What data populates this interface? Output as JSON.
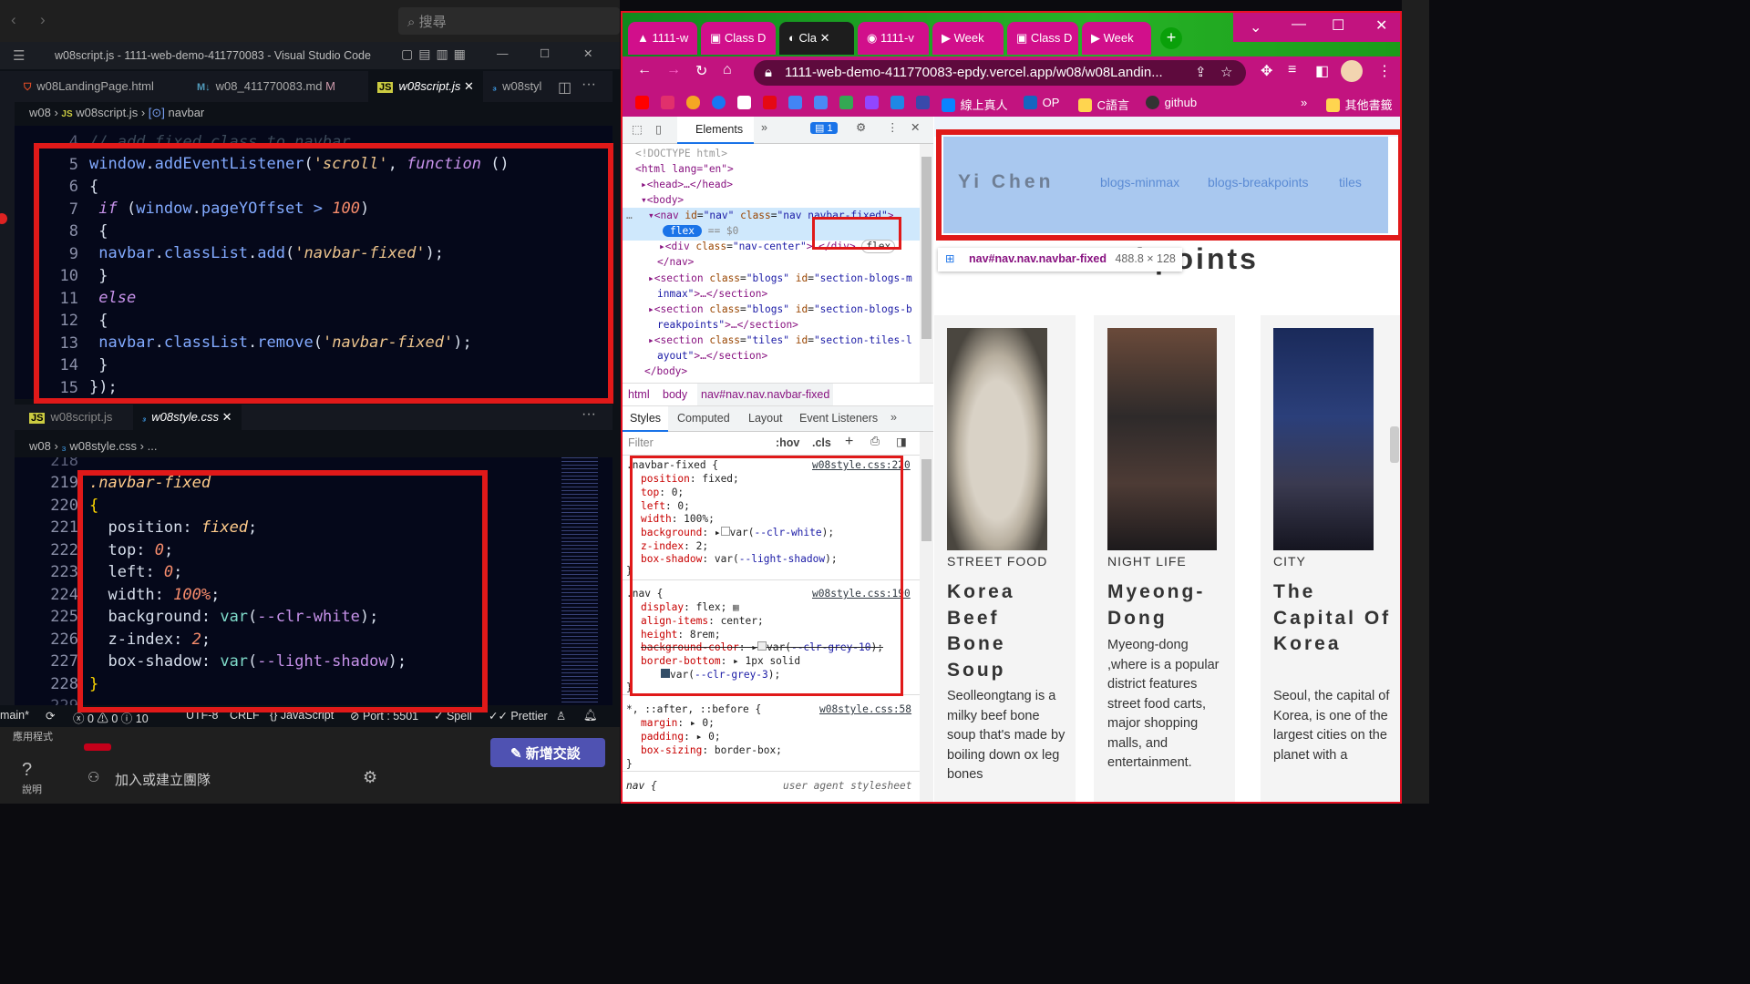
{
  "background": {
    "search_placeholder": "搜尋",
    "sidebar_apps_label": "應用程式",
    "help_label": "說明",
    "join_team_label": "加入或建立團隊",
    "new_chat_label": "新增交談"
  },
  "vscode": {
    "window_title": "w08script.js - 1111-web-demo-411770083 - Visual Studio Code",
    "tabs": [
      {
        "label": "w08LandingPage.html",
        "icon": "html-icon"
      },
      {
        "label": "w08_411770083.md",
        "badge": "M",
        "icon": "markdown-icon"
      },
      {
        "label": "w08script.js",
        "icon": "js-icon",
        "active": true
      },
      {
        "label": "w08styl",
        "icon": "css-icon"
      }
    ],
    "breadcrumb1": [
      "w08",
      "w08script.js",
      "navbar"
    ],
    "editor1": {
      "comment_line_no": "4",
      "comment": "// add fixed class to navbar",
      "line_numbers": [
        "5",
        "6",
        "7",
        "8",
        "9",
        "10",
        "11",
        "12",
        "13",
        "14",
        "15"
      ]
    },
    "lower_tabs": [
      {
        "label": "w08script.js"
      },
      {
        "label": "w08style.css",
        "active": true
      }
    ],
    "breadcrumb2": [
      "w08",
      "w08style.css",
      "..."
    ],
    "editor2": {
      "line_numbers": [
        "218",
        "219",
        "220",
        "221",
        "222",
        "223",
        "224",
        "225",
        "226",
        "227",
        "228",
        "229"
      ]
    },
    "status": {
      "branch": "main*",
      "problems": "0 ⚠ 0 ⓘ 10",
      "encoding": "UTF-8",
      "eol": "CRLF",
      "language": "JavaScript",
      "port": "Port : 5501",
      "spell": "Spell",
      "prettier": "Prettier"
    }
  },
  "chrome": {
    "tabs": [
      "1111-w",
      "Class D",
      "Cla",
      "1111-v",
      "Week ",
      "Class D",
      "Week "
    ],
    "url": "1111-web-demo-411770083-epdy.vercel.app/w08/w08Landin...",
    "bookmarks": [
      "線上真人",
      "OP",
      "C語言",
      "github",
      "其他書籤"
    ]
  },
  "devtools": {
    "tabs": [
      "Elements"
    ],
    "issues_count": "1",
    "breadcrumbs": [
      "html",
      "body",
      "nav#nav.nav.navbar-fixed"
    ],
    "subtabs": [
      "Styles",
      "Computed",
      "Layout",
      "Event Listeners"
    ],
    "filter_placeholder": "Filter",
    "hov": ":hov",
    "cls": ".cls",
    "dom": {
      "doctype": "<!DOCTYPE html>",
      "html_open": "<html lang=\"en\">",
      "head": "<head>…</head>",
      "body_open": "<body>",
      "nav_badge": "flex",
      "nav_eq": "== $0",
      "div_badge": "flex",
      "nav_close": "</nav>",
      "body_close": "</body>"
    },
    "styles": {
      "rule1_selector": ".navbar-fixed {",
      "rule1_source": "w08style.css:220",
      "rule2_selector": ".nav {",
      "rule2_source": "w08style.css:190",
      "rule3_selector": "*, ::after, ::before {",
      "rule3_source": "w08style.css:58",
      "rule4_selector": "nav {",
      "rule4_source": "user agent stylesheet"
    }
  },
  "page": {
    "logo": "Yi Chen",
    "nav_links": [
      "blogs-minmax",
      "blogs-breakpoints",
      "tiles"
    ],
    "tooltip_selector": "nav#nav.nav.navbar-fixed",
    "tooltip_size": "488.8 × 128",
    "heading": "Breakpoints",
    "cards": [
      {
        "category": "STREET FOOD",
        "title": "Korea Beef Bone Soup",
        "text": "Seolleongtang is a milky beef bone soup that's made by boiling down ox leg bones"
      },
      {
        "category": "NIGHT LIFE",
        "title": "Myeong-Dong",
        "text": "Myeong-dong ,where is a popular district features street food carts, major shopping malls, and entertainment."
      },
      {
        "category": "CITY",
        "title": "The Capital Of Korea",
        "text": "Seoul, the capital of Korea, is one of the largest cities on the planet with a"
      }
    ]
  },
  "colors": {
    "highlight_red": "#e01919",
    "chrome_theme_magenta": "#c2137f",
    "chrome_theme_green": "#1a9c1a",
    "nav_highlight": "#a9c8ef"
  }
}
